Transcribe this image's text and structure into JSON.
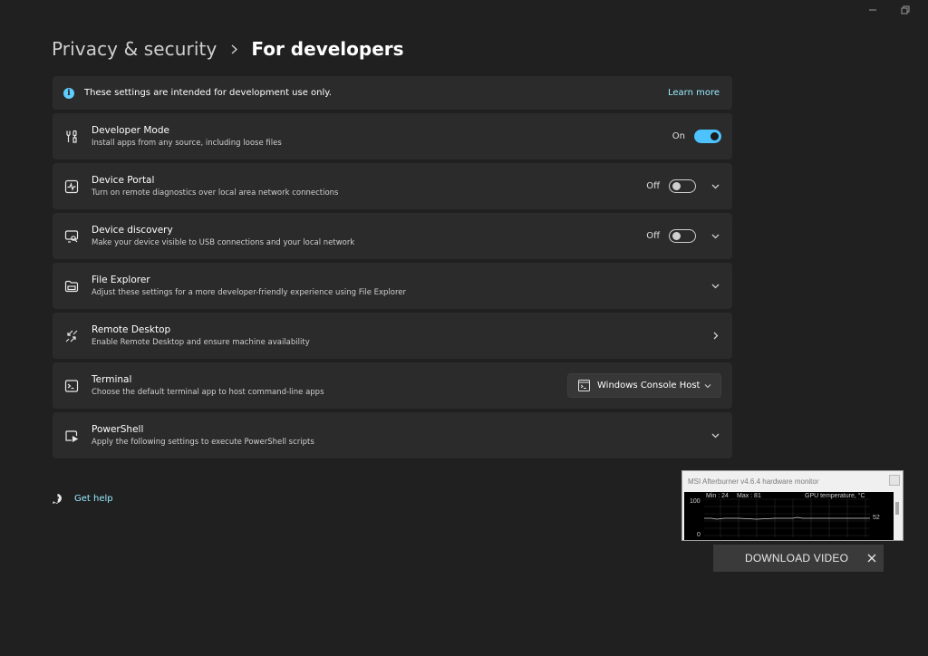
{
  "breadcrumb": {
    "parent": "Privacy & security",
    "current": "For developers"
  },
  "info_bar": {
    "icon": "info-icon",
    "text": "These settings are intended for development use only.",
    "link": "Learn more"
  },
  "settings": [
    {
      "id": "developer-mode",
      "icon": "developer-tools-icon",
      "title": "Developer Mode",
      "description": "Install apps from any source, including loose files",
      "toggle_state": "On",
      "toggle_on": true,
      "expandable": false
    },
    {
      "id": "device-portal",
      "icon": "device-portal-icon",
      "title": "Device Portal",
      "description": "Turn on remote diagnostics over local area network connections",
      "toggle_state": "Off",
      "toggle_on": false,
      "expandable": true
    },
    {
      "id": "device-discovery",
      "icon": "device-discovery-icon",
      "title": "Device discovery",
      "description": "Make your device visible to USB connections and your local network",
      "toggle_state": "Off",
      "toggle_on": false,
      "expandable": true
    },
    {
      "id": "file-explorer",
      "icon": "folder-icon",
      "title": "File Explorer",
      "description": "Adjust these settings for a more developer-friendly experience using File Explorer",
      "expandable": true
    },
    {
      "id": "remote-desktop",
      "icon": "remote-desktop-icon",
      "title": "Remote Desktop",
      "description": "Enable Remote Desktop and ensure machine availability",
      "navigates": true
    },
    {
      "id": "terminal",
      "icon": "terminal-icon",
      "title": "Terminal",
      "description": "Choose the default terminal app to host command-line apps",
      "dropdown_value": "Windows Console Host"
    },
    {
      "id": "powershell",
      "icon": "powershell-icon",
      "title": "PowerShell",
      "description": "Apply the following settings to execute PowerShell scripts",
      "expandable": true
    }
  ],
  "get_help": {
    "icon": "help-icon",
    "label": "Get help"
  },
  "afterburner": {
    "title": "MSI Afterburner v4.6.4 hardware monitor",
    "min_label": "Min : 24",
    "max_label": "Max : 81",
    "series": "GPU temperature, °C",
    "y_max": "100",
    "y_min": "0",
    "current": "52"
  },
  "download_bar": {
    "label": "DOWNLOAD VIDEO"
  },
  "colors": {
    "background": "#202020",
    "card": "#2b2b2b",
    "accent": "#4cc2ff",
    "link": "#99ebff"
  }
}
